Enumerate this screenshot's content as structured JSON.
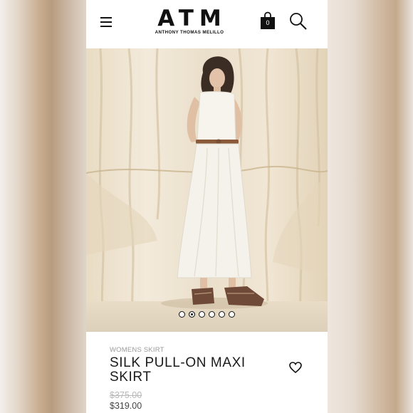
{
  "header": {
    "brand": "ATM",
    "brand_sub": "ANTHONY THOMAS MELILLO",
    "cart_count": "0",
    "icons": [
      "menu-icon",
      "shopping-bag-icon",
      "search-icon"
    ]
  },
  "carousel": {
    "slides": 6,
    "active_index": 1
  },
  "product": {
    "category": "WOMENS SKIRT",
    "title": "SILK PULL-ON MAXI SKIRT",
    "original_price": "$375.00",
    "sale_price": "$319.00",
    "wishlist_icon": "heart-icon"
  },
  "colors": {
    "text": "#1a1a1a",
    "muted": "#9b9b9b",
    "backdrop": "#efe5d3"
  }
}
